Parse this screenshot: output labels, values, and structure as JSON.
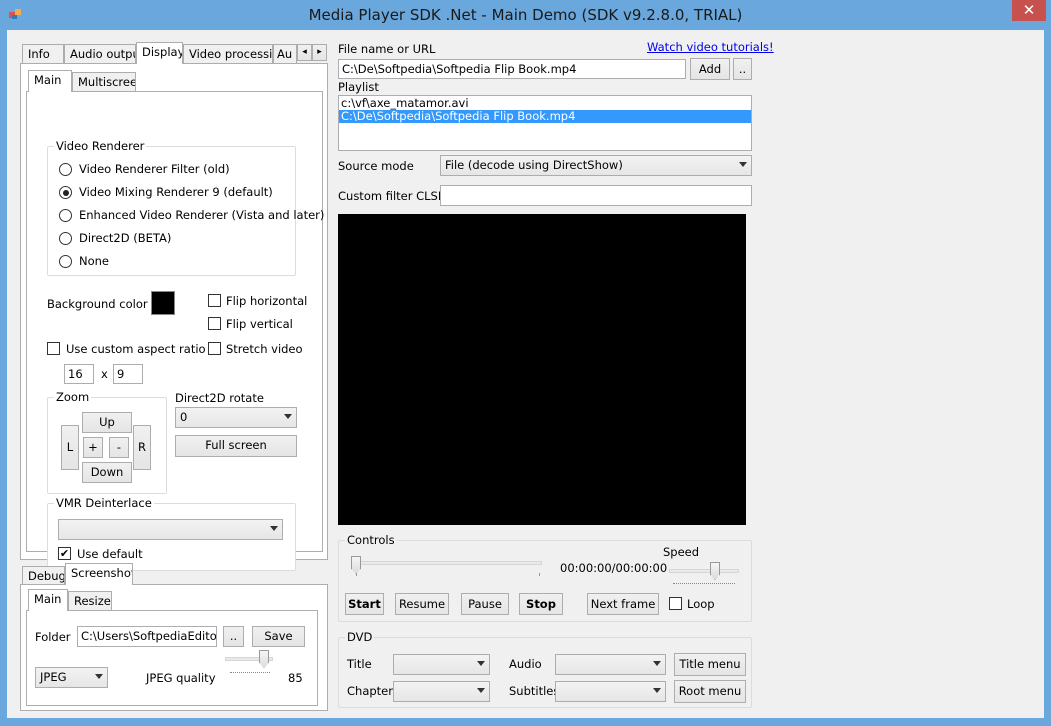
{
  "window": {
    "title": "Media Player SDK .Net - Main Demo (SDK v9.2.8.0, TRIAL)",
    "close_glyph": "✕"
  },
  "left_tabs": [
    "Info",
    "Audio output",
    "Display",
    "Video processing",
    "Au"
  ],
  "tab_scroll": {
    "left": "◂",
    "right": "▸"
  },
  "display_subtabs": [
    "Main",
    "Multiscreen"
  ],
  "video_renderer": {
    "label": "Video Renderer",
    "options": [
      "Video Renderer Filter (old)",
      "Video Mixing Renderer 9 (default)",
      "Enhanced Video Renderer (Vista and later)",
      "Direct2D (BETA)",
      "None"
    ],
    "selected": 1
  },
  "background_color": {
    "label": "Background color",
    "color": "#000000"
  },
  "flip_horizontal": "Flip horizontal",
  "flip_vertical": "Flip vertical",
  "stretch_video": "Stretch video",
  "custom_aspect": {
    "label": "Use custom aspect ratio",
    "w": "16",
    "sep": "x",
    "h": "9"
  },
  "zoom": {
    "label": "Zoom",
    "up": "Up",
    "down": "Down",
    "left": "L",
    "right": "R",
    "plus": "+",
    "minus": "-"
  },
  "direct2d": {
    "label": "Direct2D rotate",
    "value": "0",
    "full_screen": "Full screen"
  },
  "vmr_deinterlace": {
    "label": "VMR Deinterlace",
    "value": "",
    "use_default": "Use default"
  },
  "bottom_tabs": [
    "Debug",
    "Screenshot"
  ],
  "screenshot_subtabs": [
    "Main",
    "Resize"
  ],
  "screenshot": {
    "folder_label": "Folder",
    "folder_value": "C:\\Users\\SoftpediaEditor\\De",
    "browse": "..",
    "save": "Save",
    "format": "JPEG",
    "quality_label": "JPEG quality",
    "quality_value": "85",
    "quality_level_pct": 85
  },
  "file": {
    "label": "File name or URL",
    "tutorial_link": "Watch video tutorials!",
    "value": "C:\\De\\Softpedia\\Softpedia Flip Book.mp4",
    "add": "Add",
    "browse": ".."
  },
  "playlist": {
    "label": "Playlist",
    "items": [
      "c:\\vf\\axe_matamor.avi",
      "C:\\De\\Softpedia\\Softpedia Flip Book.mp4"
    ],
    "selected": 1
  },
  "source_mode": {
    "label": "Source mode",
    "value": "File (decode using DirectShow)"
  },
  "custom_filter": {
    "label": "Custom filter CLSID",
    "value": ""
  },
  "controls": {
    "label": "Controls",
    "time": "00:00:00/00:00:00",
    "speed_label": "Speed",
    "start": "Start",
    "resume": "Resume",
    "pause": "Pause",
    "stop": "Stop",
    "next_frame": "Next frame",
    "loop": "Loop"
  },
  "dvd": {
    "label": "DVD",
    "title_label": "Title",
    "chapter_label": "Chapter",
    "audio_label": "Audio",
    "subtitles_label": "Subtitles",
    "title_menu": "Title menu",
    "root_menu": "Root menu"
  }
}
